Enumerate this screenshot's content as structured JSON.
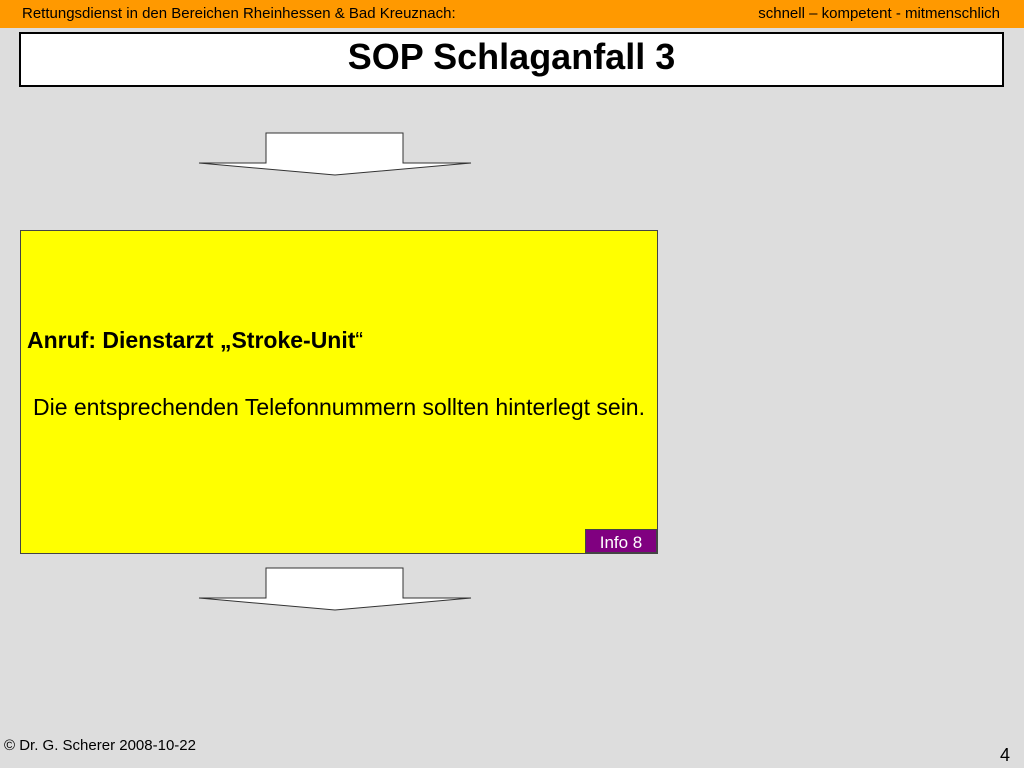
{
  "header": {
    "left": "Rettungsdienst in den Bereichen Rheinhessen & Bad Kreuznach:",
    "right": "schnell – kompetent - mitmenschlich"
  },
  "title": "SOP Schlaganfall 3",
  "box": {
    "heading": "Anruf: Dienstarzt „Stroke-Unit",
    "heading_quote": "“",
    "body": "Die entsprechenden Telefonnummern sollten hinterlegt sein.",
    "info_label": "Info 8"
  },
  "footer": {
    "copyright": "© Dr. G. Scherer 2008-10-22",
    "page_number": "4"
  },
  "colors": {
    "header_bg": "#ff9900",
    "box_bg": "#ffff00",
    "info_bg": "#800080",
    "slide_bg": "#dddddd"
  }
}
